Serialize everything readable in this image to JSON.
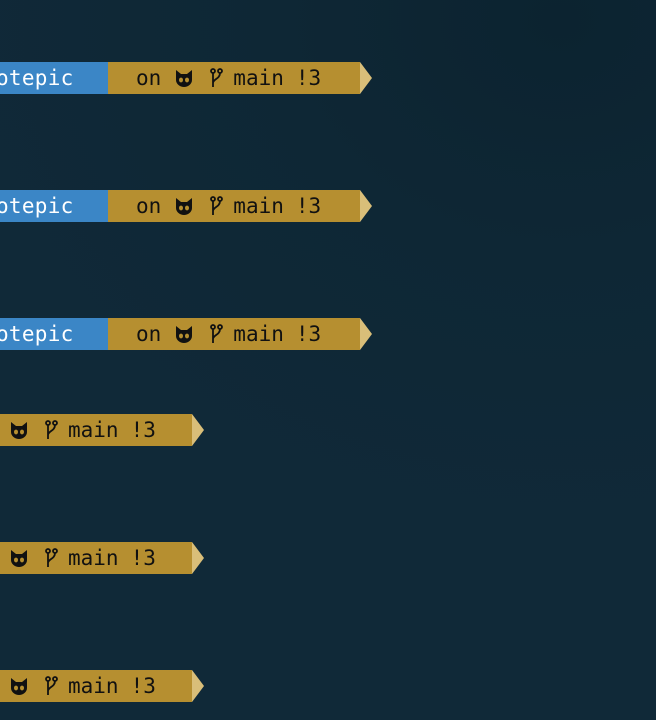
{
  "prompts": [
    {
      "dir": "notepic",
      "connector": "on",
      "branch": "main",
      "status": "!3"
    },
    {
      "dir": "notepic",
      "connector": "on",
      "branch": "main",
      "status": "!3"
    },
    {
      "dir": "notepic",
      "connector": "on",
      "branch": "main",
      "status": "!3"
    },
    {
      "branch": "main",
      "status": "!3"
    },
    {
      "branch": "main",
      "status": "!3"
    },
    {
      "branch": "main",
      "status": "!3"
    }
  ],
  "icons": {
    "host": "github-octocat-icon",
    "branch": "git-branch-icon"
  },
  "colors": {
    "background": "#0f2835",
    "dir_segment": "#3b86c6",
    "git_segment": "#b68f30",
    "tail": "#d9be79"
  }
}
